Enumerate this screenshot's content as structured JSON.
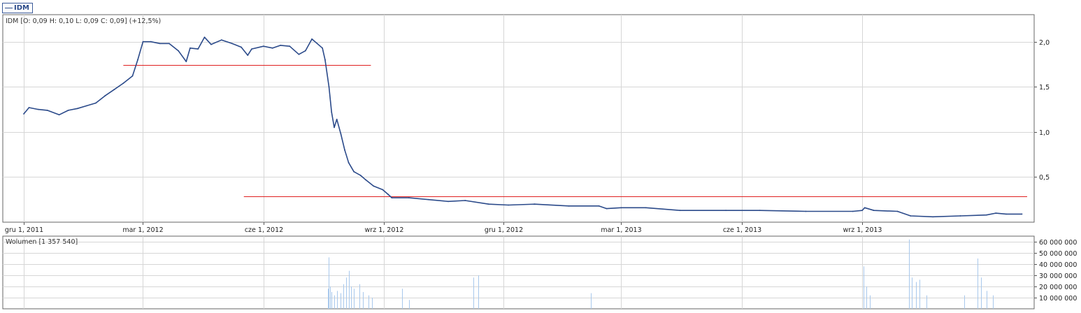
{
  "legend": {
    "label": "IDM"
  },
  "price_panel": {
    "header": "IDM [O: 0,09  H: 0,10  L: 0,09  C: 0,09] (+12,5%)"
  },
  "volume_panel": {
    "header": "Wolumen [1 357 540]"
  },
  "colors": {
    "price": "#2b4a8a",
    "volume": "#a8c8ec",
    "reference_lines": "#e02020",
    "grid": "#d6d6d6",
    "axis": "#555555"
  },
  "chart_data": [
    {
      "type": "line",
      "title": "IDM [O: 0,09  H: 0,10  L: 0,09  C: 0,09] (+12,5%)",
      "xlabel": "",
      "ylabel": "",
      "x_range": [
        "2011-12-01",
        "2014-01-05"
      ],
      "x_tick_labels": [
        "gru 1, 2011",
        "mar 1, 2012",
        "cze 1, 2012",
        "wrz 1, 2012",
        "gru 1, 2012",
        "mar 1, 2013",
        "cze 1, 2013",
        "wrz 1, 2013"
      ],
      "x_tick_dates": [
        "2011-12-01",
        "2012-03-01",
        "2012-06-01",
        "2012-09-01",
        "2012-12-01",
        "2013-03-01",
        "2013-06-01",
        "2013-09-01"
      ],
      "ylim": [
        0.0,
        2.3
      ],
      "y_ticks": [
        0.5,
        1.0,
        1.5,
        2.0
      ],
      "y_tick_labels": [
        "0,5",
        "1,0",
        "1,5",
        "2,0"
      ],
      "grid": true,
      "series": [
        {
          "name": "IDM",
          "points": [
            [
              "2011-12-01",
              1.2
            ],
            [
              "2011-12-05",
              1.27
            ],
            [
              "2011-12-12",
              1.25
            ],
            [
              "2011-12-19",
              1.24
            ],
            [
              "2011-12-28",
              1.19
            ],
            [
              "2012-01-04",
              1.24
            ],
            [
              "2012-01-11",
              1.26
            ],
            [
              "2012-01-18",
              1.29
            ],
            [
              "2012-01-25",
              1.32
            ],
            [
              "2012-02-01",
              1.4
            ],
            [
              "2012-02-08",
              1.47
            ],
            [
              "2012-02-15",
              1.54
            ],
            [
              "2012-02-22",
              1.62
            ],
            [
              "2012-02-26",
              1.8
            ],
            [
              "2012-03-01",
              2.0
            ],
            [
              "2012-03-07",
              2.0
            ],
            [
              "2012-03-14",
              1.98
            ],
            [
              "2012-03-21",
              1.98
            ],
            [
              "2012-03-28",
              1.9
            ],
            [
              "2012-04-03",
              1.78
            ],
            [
              "2012-04-06",
              1.93
            ],
            [
              "2012-04-12",
              1.92
            ],
            [
              "2012-04-17",
              2.05
            ],
            [
              "2012-04-22",
              1.97
            ],
            [
              "2012-04-30",
              2.02
            ],
            [
              "2012-05-08",
              1.98
            ],
            [
              "2012-05-15",
              1.94
            ],
            [
              "2012-05-20",
              1.85
            ],
            [
              "2012-05-23",
              1.92
            ],
            [
              "2012-06-01",
              1.95
            ],
            [
              "2012-06-08",
              1.93
            ],
            [
              "2012-06-14",
              1.96
            ],
            [
              "2012-06-21",
              1.95
            ],
            [
              "2012-06-28",
              1.86
            ],
            [
              "2012-07-03",
              1.9
            ],
            [
              "2012-07-08",
              2.03
            ],
            [
              "2012-07-12",
              1.98
            ],
            [
              "2012-07-16",
              1.93
            ],
            [
              "2012-07-18",
              1.8
            ],
            [
              "2012-07-21",
              1.5
            ],
            [
              "2012-07-23",
              1.22
            ],
            [
              "2012-07-25",
              1.05
            ],
            [
              "2012-07-27",
              1.14
            ],
            [
              "2012-07-30",
              0.98
            ],
            [
              "2012-08-02",
              0.8
            ],
            [
              "2012-08-05",
              0.66
            ],
            [
              "2012-08-09",
              0.56
            ],
            [
              "2012-08-14",
              0.52
            ],
            [
              "2012-08-18",
              0.47
            ],
            [
              "2012-08-24",
              0.4
            ],
            [
              "2012-08-31",
              0.36
            ],
            [
              "2012-09-04",
              0.31
            ],
            [
              "2012-09-07",
              0.27
            ],
            [
              "2012-09-20",
              0.27
            ],
            [
              "2012-10-05",
              0.25
            ],
            [
              "2012-10-20",
              0.23
            ],
            [
              "2012-11-02",
              0.24
            ],
            [
              "2012-11-20",
              0.2
            ],
            [
              "2012-12-05",
              0.19
            ],
            [
              "2012-12-25",
              0.2
            ],
            [
              "2013-01-20",
              0.18
            ],
            [
              "2013-02-12",
              0.18
            ],
            [
              "2013-02-18",
              0.15
            ],
            [
              "2013-03-01",
              0.16
            ],
            [
              "2013-03-20",
              0.16
            ],
            [
              "2013-04-15",
              0.13
            ],
            [
              "2013-05-20",
              0.13
            ],
            [
              "2013-06-15",
              0.13
            ],
            [
              "2013-07-20",
              0.12
            ],
            [
              "2013-08-25",
              0.12
            ],
            [
              "2013-09-01",
              0.13
            ],
            [
              "2013-09-03",
              0.16
            ],
            [
              "2013-09-10",
              0.13
            ],
            [
              "2013-09-28",
              0.12
            ],
            [
              "2013-10-08",
              0.07
            ],
            [
              "2013-10-25",
              0.06
            ],
            [
              "2013-11-15",
              0.07
            ],
            [
              "2013-12-05",
              0.08
            ],
            [
              "2013-12-12",
              0.1
            ],
            [
              "2013-12-20",
              0.09
            ],
            [
              "2014-01-01",
              0.09
            ]
          ]
        }
      ],
      "reference_lines": [
        {
          "x_start": "2012-02-15",
          "x_end": "2012-08-22",
          "y": 1.74
        },
        {
          "x_start": "2012-05-17",
          "x_end": "2014-01-05",
          "y": 0.29
        }
      ]
    },
    {
      "type": "bar",
      "title": "Wolumen [1 357 540]",
      "xlabel": "",
      "ylabel": "",
      "ylim": [
        0,
        65000000
      ],
      "y_ticks": [
        10000000,
        20000000,
        30000000,
        40000000,
        50000000,
        60000000
      ],
      "y_tick_labels": [
        "10 000 000",
        "20 000 000",
        "30 000 000",
        "40 000 000",
        "50 000 000",
        "60 000 000"
      ],
      "grid": true,
      "bar_spikes": [
        [
          "2012-07-20",
          18000000
        ],
        [
          "2012-07-21",
          46000000
        ],
        [
          "2012-07-22",
          20000000
        ],
        [
          "2012-07-23",
          15000000
        ],
        [
          "2012-07-25",
          12000000
        ],
        [
          "2012-07-27",
          16000000
        ],
        [
          "2012-07-30",
          14000000
        ],
        [
          "2012-08-01",
          22000000
        ],
        [
          "2012-08-03",
          28000000
        ],
        [
          "2012-08-05",
          34000000
        ],
        [
          "2012-08-07",
          20000000
        ],
        [
          "2012-08-09",
          18000000
        ],
        [
          "2012-08-13",
          22000000
        ],
        [
          "2012-08-16",
          15000000
        ],
        [
          "2012-08-20",
          12000000
        ],
        [
          "2012-08-23",
          10000000
        ],
        [
          "2012-09-15",
          18000000
        ],
        [
          "2012-09-20",
          8000000
        ],
        [
          "2012-11-08",
          28000000
        ],
        [
          "2012-11-12",
          30000000
        ],
        [
          "2013-02-06",
          14000000
        ],
        [
          "2013-09-02",
          38000000
        ],
        [
          "2013-09-04",
          20000000
        ],
        [
          "2013-09-07",
          12000000
        ],
        [
          "2013-10-07",
          62000000
        ],
        [
          "2013-10-09",
          28000000
        ],
        [
          "2013-10-12",
          24000000
        ],
        [
          "2013-10-15",
          26000000
        ],
        [
          "2013-10-20",
          12000000
        ],
        [
          "2013-11-18",
          12000000
        ],
        [
          "2013-11-28",
          45000000
        ],
        [
          "2013-12-01",
          28000000
        ],
        [
          "2013-12-05",
          16000000
        ],
        [
          "2013-12-10",
          12000000
        ]
      ]
    }
  ]
}
